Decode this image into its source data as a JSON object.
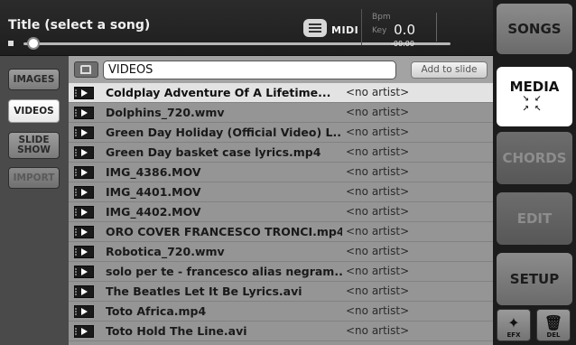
{
  "player": {
    "title": "Title (select a song)",
    "midi_label": "MIDI",
    "bpm_label": "Bpm",
    "key_label": "Key",
    "time": "0.0",
    "remaining": "-00:00"
  },
  "sidebar": {
    "items": [
      {
        "label": "IMAGES"
      },
      {
        "label": "VIDEOS"
      },
      {
        "label": "SLIDE SHOW"
      },
      {
        "label": "IMPORT"
      }
    ]
  },
  "list": {
    "folder": "VIDEOS",
    "add_to_slide": "Add to slide",
    "rows": [
      {
        "title": "Coldplay  Adventure Of A Lifetime...",
        "artist": "<no artist>"
      },
      {
        "title": "Dolphins_720.wmv",
        "artist": "<no artist>"
      },
      {
        "title": "Green Day  Holiday (Official Video) L...",
        "artist": "<no artist>"
      },
      {
        "title": "Green Day basket case lyrics.mp4",
        "artist": "<no artist>"
      },
      {
        "title": "IMG_4386.MOV",
        "artist": "<no artist>"
      },
      {
        "title": "IMG_4401.MOV",
        "artist": "<no artist>"
      },
      {
        "title": "IMG_4402.MOV",
        "artist": "<no artist>"
      },
      {
        "title": "ORO COVER FRANCESCO TRONCI.mp4",
        "artist": "<no artist>"
      },
      {
        "title": "Robotica_720.wmv",
        "artist": "<no artist>"
      },
      {
        "title": "solo per te - francesco alias negram...",
        "artist": "<no artist>"
      },
      {
        "title": "The Beatles  Let It Be Lyrics.avi",
        "artist": "<no artist>"
      },
      {
        "title": "Toto  Africa.mp4",
        "artist": "<no artist>"
      },
      {
        "title": "Toto  Hold The Line.avi",
        "artist": "<no artist>"
      }
    ]
  },
  "nav": {
    "songs": "SONGS",
    "media": "MEDIA",
    "chords": "CHORDS",
    "edit": "EDIT",
    "setup": "SETUP",
    "efx": "EFX",
    "del": "DEL"
  }
}
